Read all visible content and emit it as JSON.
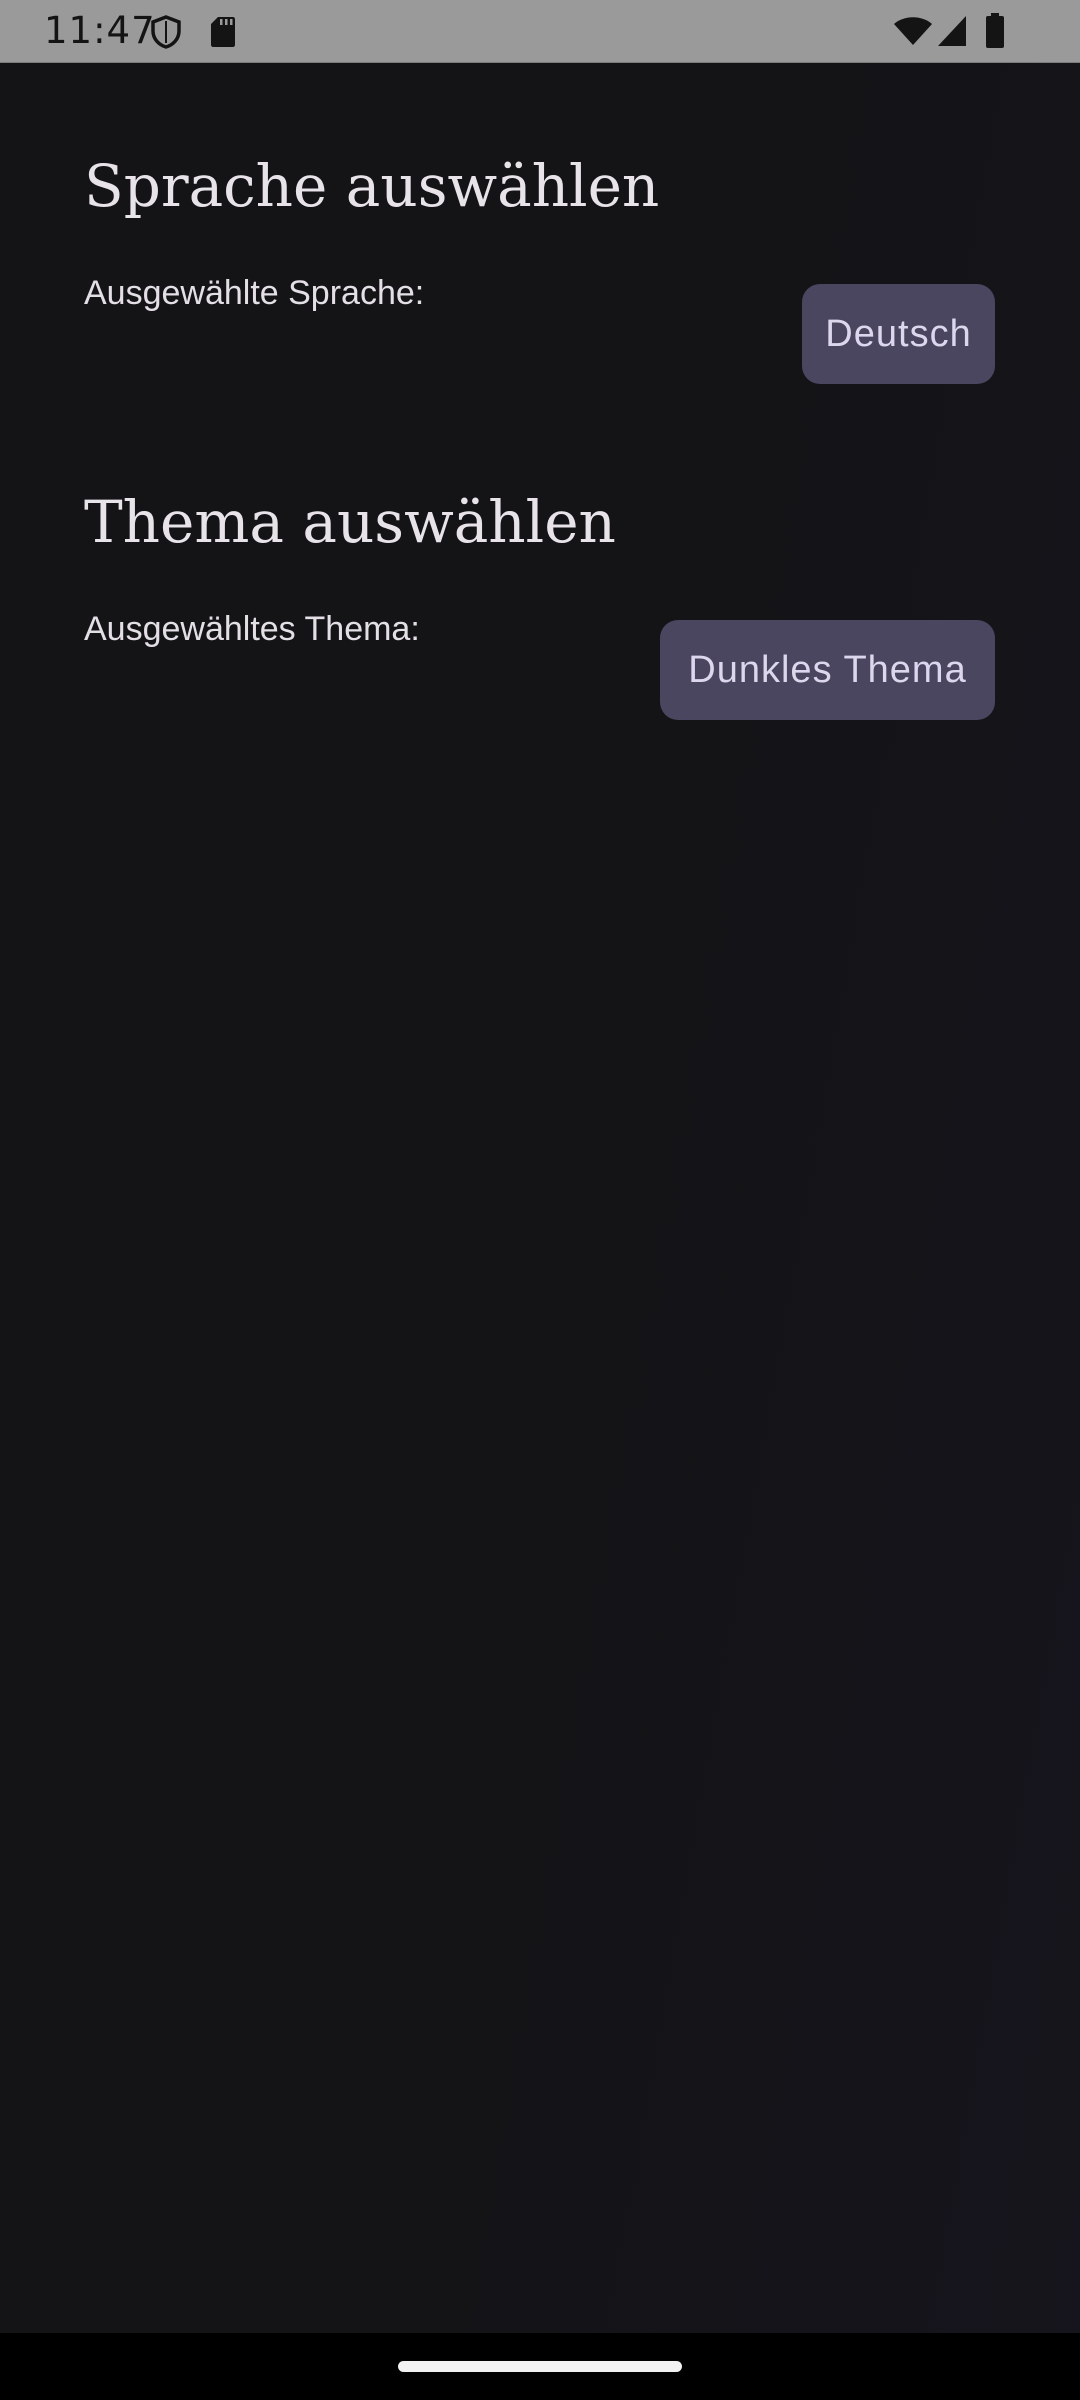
{
  "status_bar": {
    "time": "11:47",
    "icons": [
      "shield-icon",
      "sd-card-icon",
      "wifi-icon",
      "signal-icon",
      "battery-icon"
    ]
  },
  "language": {
    "title": "Sprache auswählen",
    "label": "Ausgewählte Sprache:",
    "button": "Deutsch"
  },
  "theme": {
    "title": "Thema auswählen",
    "label": "Ausgewähltes Thema:",
    "button": "Dunkles Thema"
  },
  "colors": {
    "background": "#141316",
    "button_bg": "#4a4660",
    "button_text": "#dcd7ec",
    "text": "#e6e1e6",
    "status_bar": "#9a9a9a"
  }
}
